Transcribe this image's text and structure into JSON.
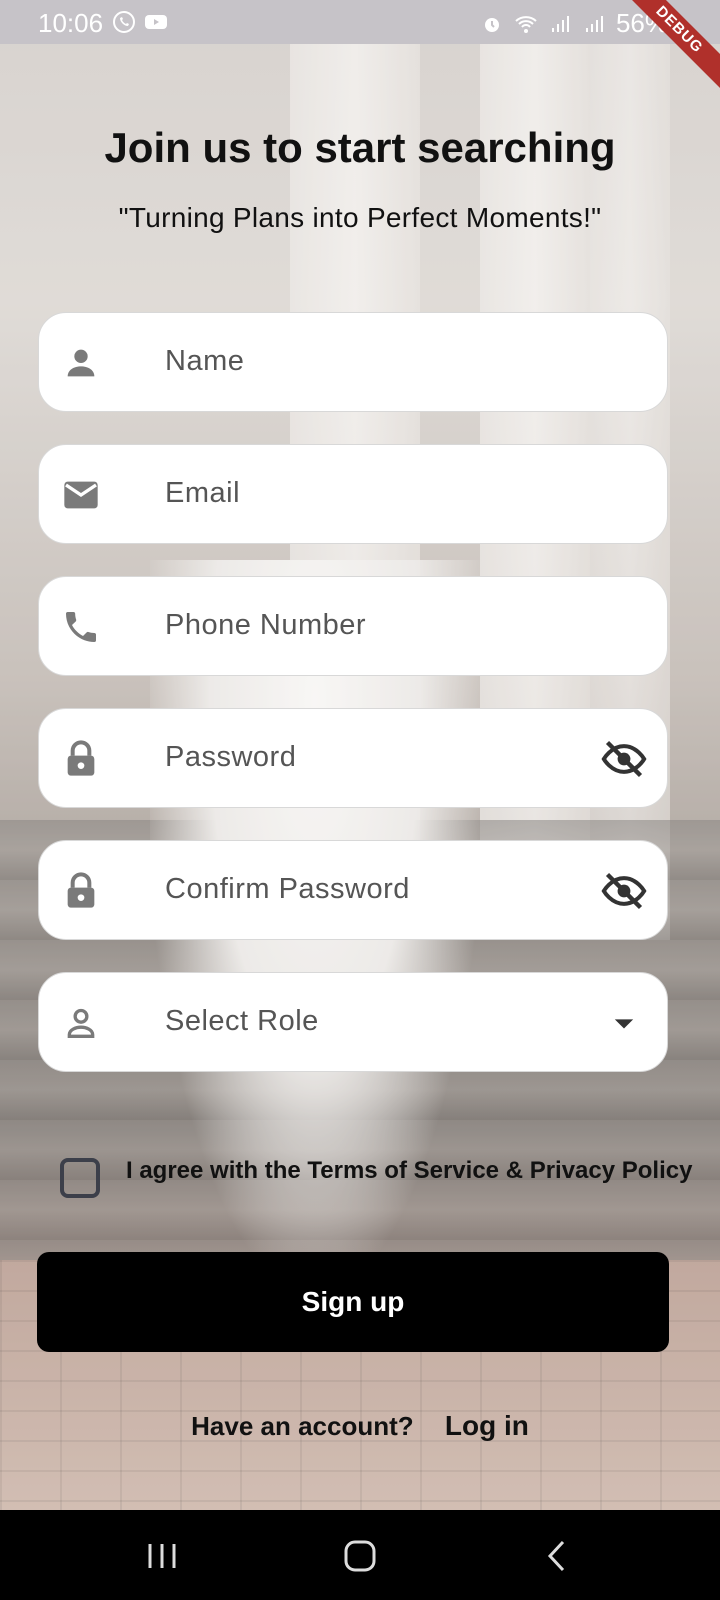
{
  "status_bar": {
    "time": "10:06",
    "battery": "56%",
    "left_icons": [
      "whatsapp-icon",
      "youtube-icon"
    ],
    "right_icons": [
      "alarm-icon",
      "wifi-icon",
      "signal-icon",
      "signal-icon",
      "battery-icon"
    ],
    "debug_label": "DEBUG"
  },
  "header": {
    "title": "Join us to start searching",
    "subtitle": "\"Turning Plans into Perfect Moments!\""
  },
  "form": {
    "name_placeholder": "Name",
    "email_placeholder": "Email",
    "phone_placeholder": "Phone Number",
    "password_placeholder": "Password",
    "confirm_password_placeholder": "Confirm Password",
    "role_placeholder": "Select Role",
    "terms_label": "I agree with the Terms of Service & Privacy Policy",
    "terms_checked": false
  },
  "actions": {
    "signup_label": "Sign up",
    "have_account_text": "Have an account?",
    "login_label": "Log in"
  },
  "colors": {
    "button_bg": "#000000",
    "field_bg": "#ffffff",
    "icon_gray": "#7a7a7a"
  }
}
